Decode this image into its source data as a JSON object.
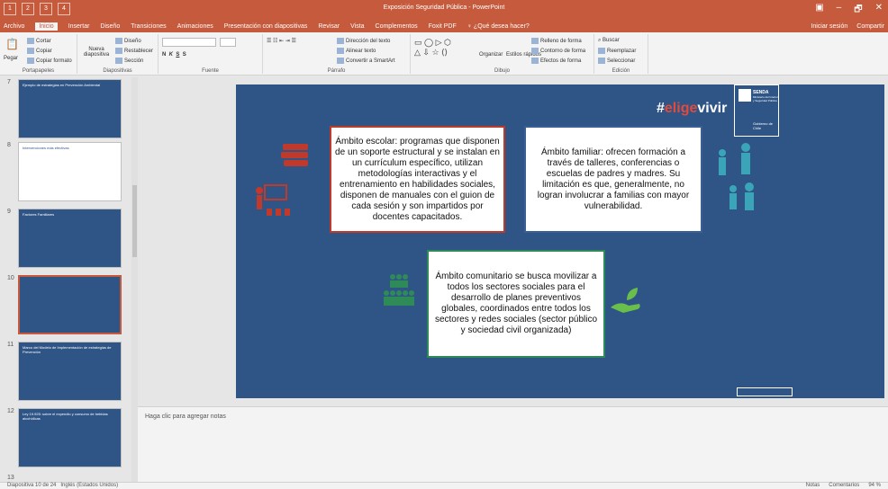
{
  "titlebar": {
    "title": "Exposición Seguridad Pública - PowerPoint",
    "qat_keys": [
      "1",
      "2",
      "3",
      "4"
    ],
    "controls": [
      "▣",
      "–",
      "🗗",
      "✕"
    ]
  },
  "menubar": {
    "tabs": [
      "Archivo",
      "Inicio",
      "Insertar",
      "Diseño",
      "Transiciones",
      "Animaciones",
      "Presentación con diapositivas",
      "Revisar",
      "Vista",
      "Complementos",
      "Foxit PDF",
      "♀ ¿Qué desea hacer?"
    ],
    "signin": "Iniciar sesión",
    "share": "Compartir"
  },
  "ribbon": {
    "groups": {
      "clipboard": {
        "label": "Portapapeles",
        "paste": "Pegar",
        "cut": "Cortar",
        "copy": "Copiar",
        "format": "Copiar formato"
      },
      "slides": {
        "label": "Diapositivas",
        "new": "Nueva diapositiva",
        "layout": "Diseño",
        "reset": "Restablecer",
        "section": "Sección"
      },
      "font": {
        "label": "Fuente"
      },
      "paragraph": {
        "label": "Párrafo",
        "direction": "Dirección del texto",
        "align": "Alinear texto",
        "smartart": "Convertir a SmartArt"
      },
      "drawing": {
        "label": "Dibujo",
        "arrange": "Organizar",
        "styles": "Estilos rápidos",
        "fill": "Relleno de forma",
        "outline": "Contorno de forma",
        "effects": "Efectos de forma"
      },
      "editing": {
        "label": "Edición",
        "find": "Buscar",
        "replace": "Reemplazar",
        "select": "Seleccionar"
      }
    }
  },
  "thumbnails": [
    {
      "num": "7",
      "title": "Ejemplo de estrategias en Prevención Ambiental"
    },
    {
      "num": "8",
      "title": "Intervenciones más efectivas"
    },
    {
      "num": "9",
      "title": "Factores Familiares"
    },
    {
      "num": "10",
      "title": ""
    },
    {
      "num": "11",
      "title": "Marco del Modelo de Implementación de estrategias de Prevención"
    },
    {
      "num": "12",
      "title": "Ley 19.925: sobre el expendio y consumo de bebidas alcohólicas"
    },
    {
      "num": "13",
      "title": ""
    }
  ],
  "slide": {
    "brand_hash": "#",
    "brand_red": "elige",
    "brand_white": "vivir",
    "gov_senda": "SENDA",
    "gov_sub": "Ministerio del Interior y Seguridad Pública",
    "gov_gob": "Gobierno de Chile",
    "box1": "Ámbito escolar: programas que disponen de un soporte estructural y se instalan en un currículum específico, utilizan metodologías interactivas y el entrenamiento en habilidades sociales, disponen de manuales con el guion de cada sesión y son impartidos por docentes capacitados.",
    "box2": "Ámbito familiar: ofrecen formación a través de talleres, conferencias o escuelas de padres y madres. Su limitación es que, generalmente, no logran involucrar a familias con mayor vulnerabilidad.",
    "box3": "Ámbito comunitario se busca movilizar a todos los sectores sociales para el desarrollo de planes preventivos globales, coordinados entre todos los sectores y redes sociales (sector público y sociedad civil organizada)"
  },
  "notes": {
    "placeholder": "Haga clic para agregar notas"
  },
  "status": {
    "slide": "Diapositiva 10 de 24",
    "lang": "Inglés (Estados Unidos)",
    "notes": "Notas",
    "comments": "Comentarios",
    "zoom": "94 %"
  },
  "colors": {
    "accent": "#c55a3c",
    "slide_bg": "#2f5587"
  }
}
